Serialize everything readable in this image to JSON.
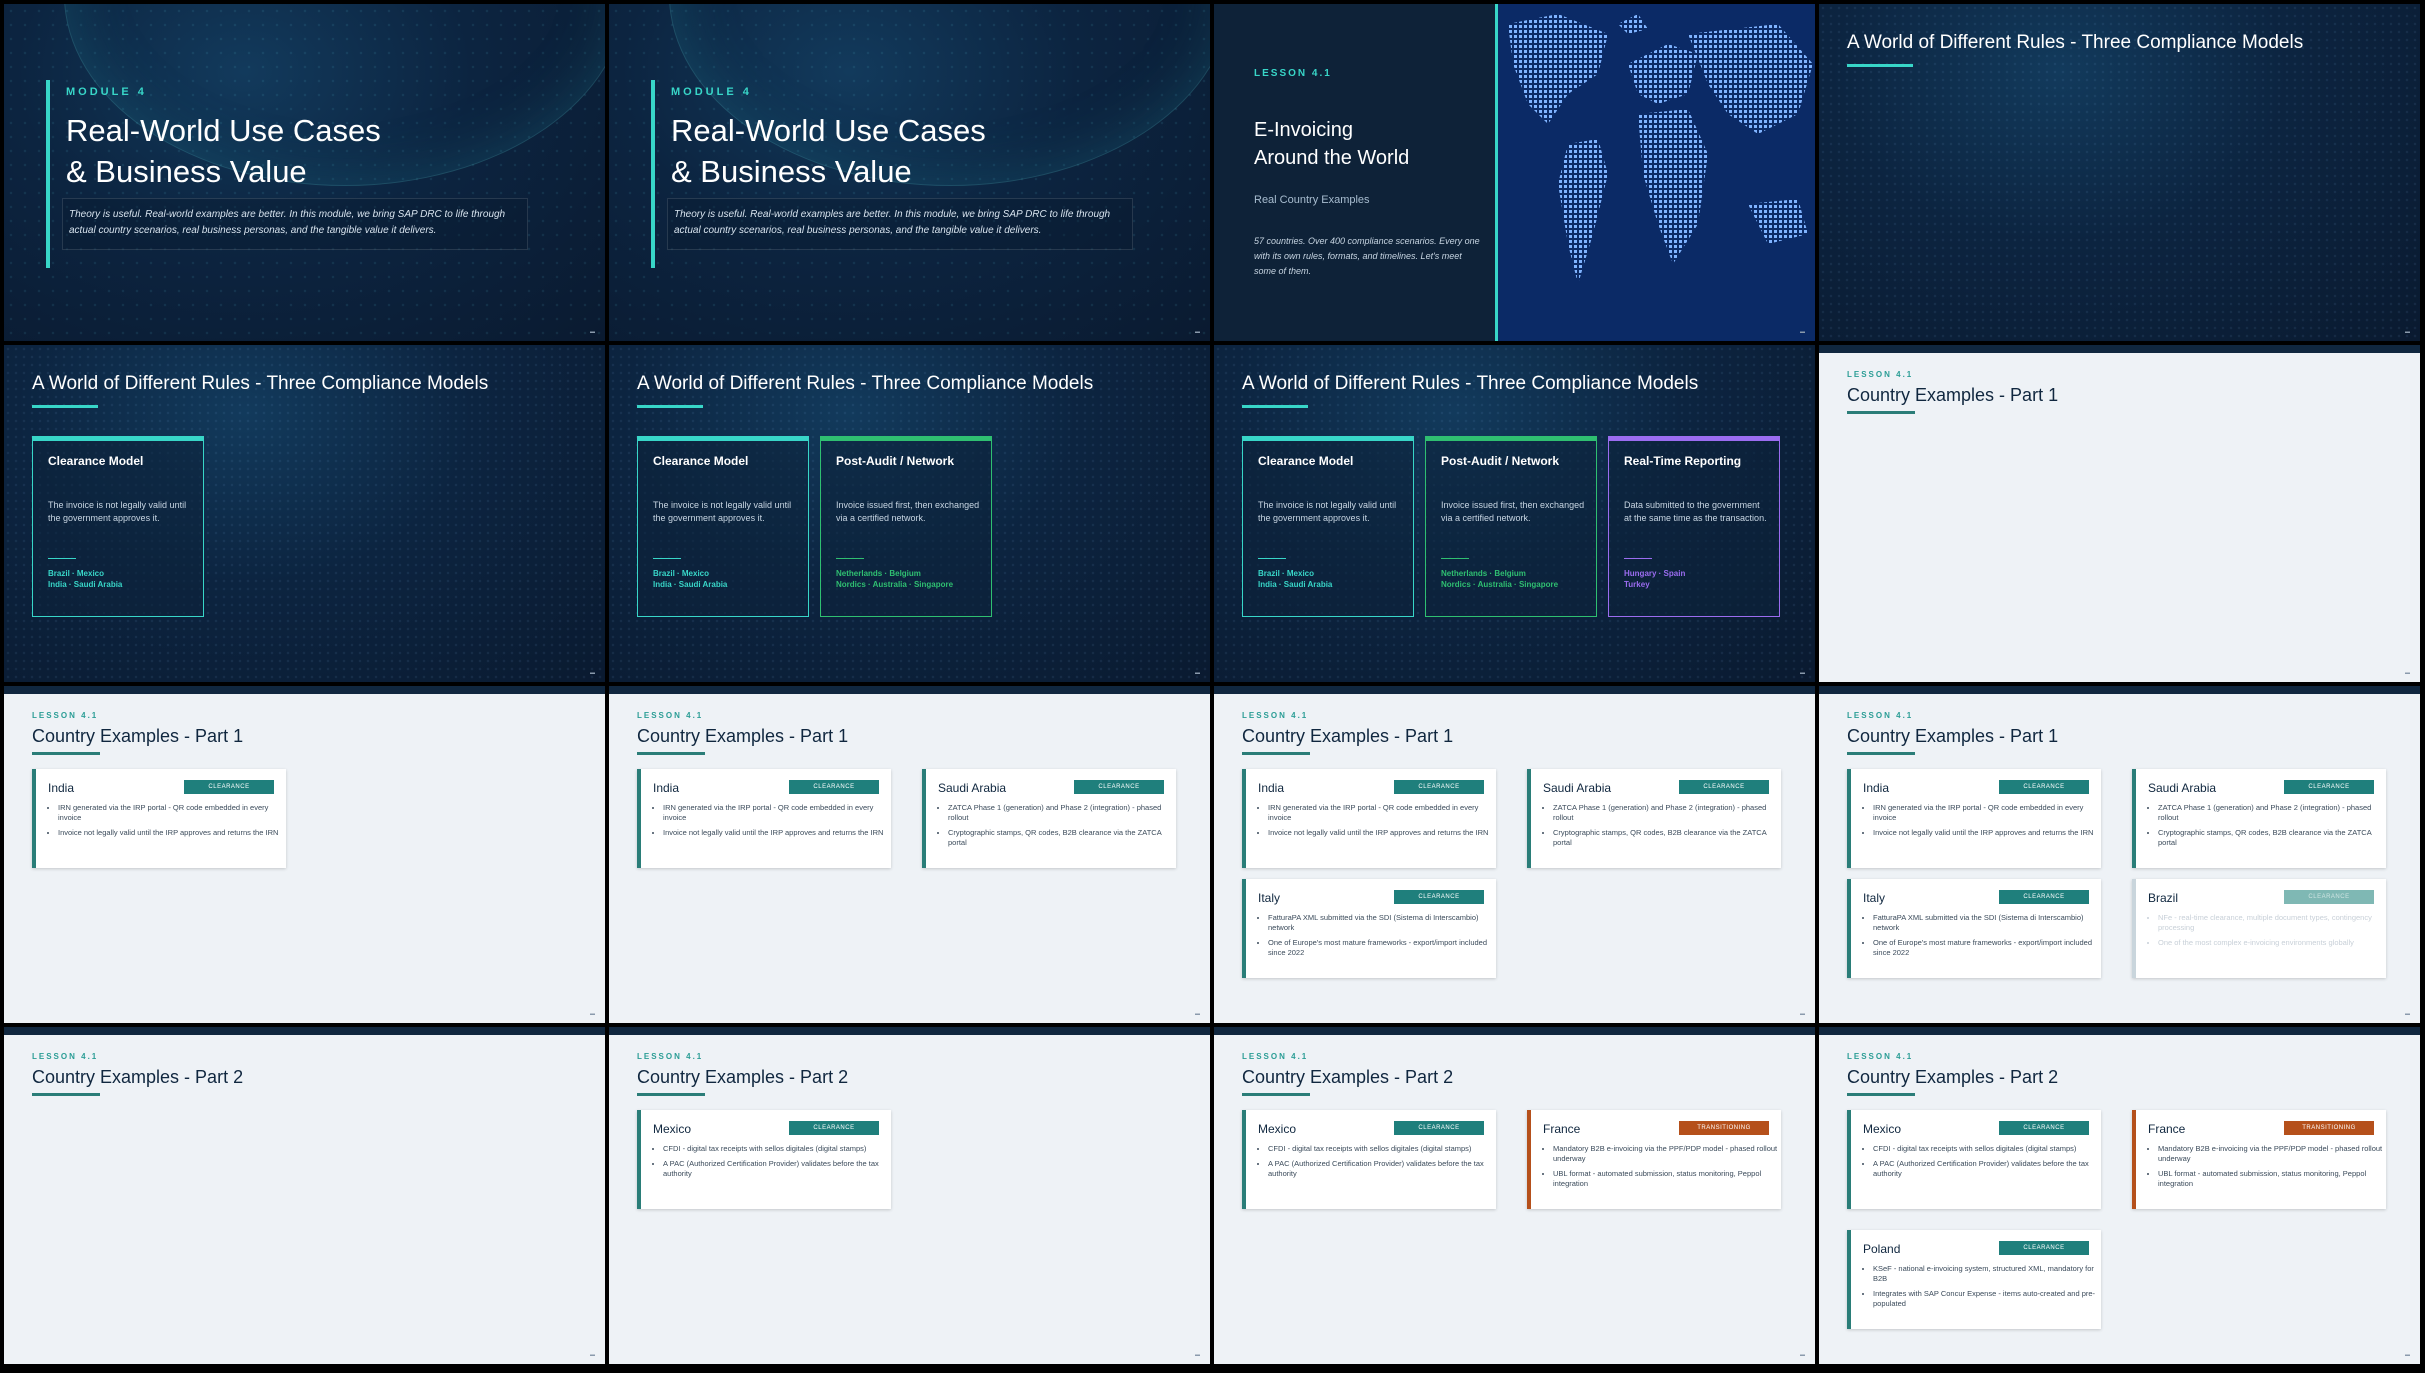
{
  "colors": {
    "accent_teal": "#38d6c8",
    "clearance": "#1f7f7c",
    "post_audit": "#2fbf71",
    "realtime": "#9b6cf0",
    "transitioning": "#b5501b",
    "dark_bg": "#0c2440",
    "light_bg": "#eef2f6"
  },
  "title_slide": {
    "module": "MODULE 4",
    "title_line1": "Real-World Use Cases",
    "title_line2": "& Business Value",
    "description": "Theory is useful. Real-world examples are better. In this module, we bring SAP DRC to life through actual country scenarios, real business personas, and the tangible value it delivers."
  },
  "lesson_slide": {
    "lesson": "LESSON 4.1",
    "title_line1": "E-Invoicing",
    "title_line2": "Around the World",
    "subtitle": "Real Country Examples",
    "description": "57 countries. Over 400 compliance scenarios. Every one with its own rules, formats, and timelines. Let's meet some of them."
  },
  "compliance": {
    "title": "A World of Different Rules - Three Compliance Models",
    "models": [
      {
        "title": "Clearance Model",
        "desc": "The invoice is not legally valid until the government approves it.",
        "countries_line1": "Brazil · Mexico",
        "countries_line2": "India · Saudi Arabia"
      },
      {
        "title": "Post-Audit / Network",
        "desc": "Invoice issued first, then exchanged via a certified network.",
        "countries_line1": "Netherlands · Belgium",
        "countries_line2": "Nordics · Australia · Singapore"
      },
      {
        "title": "Real-Time Reporting",
        "desc": "Data submitted to the government at the same time as the transaction.",
        "countries_line1": "Hungary · Spain",
        "countries_line2": "Turkey"
      }
    ]
  },
  "country": {
    "lesson": "LESSON 4.1",
    "part1_title": "Country Examples - Part 1",
    "part2_title": "Country Examples - Part 2",
    "badge_clearance": "CLEARANCE",
    "badge_transitioning": "TRANSITIONING",
    "india": {
      "name": "India",
      "b1": "IRN generated via the IRP portal - QR code embedded in every invoice",
      "b2": "Invoice not legally valid until the IRP approves and returns the IRN"
    },
    "saudi": {
      "name": "Saudi Arabia",
      "b1": "ZATCA Phase 1 (generation) and Phase 2 (integration) - phased rollout",
      "b2": "Cryptographic stamps, QR codes, B2B clearance via the ZATCA portal"
    },
    "italy": {
      "name": "Italy",
      "b1": "FatturaPA XML submitted via the SDI (Sistema di Interscambio) network",
      "b2": "One of Europe's most mature frameworks - export/import included since 2022"
    },
    "brazil": {
      "name": "Brazil",
      "b1": "NFe - real-time clearance, multiple document types, contingency processing",
      "b2": "One of the most complex e-invoicing environments globally"
    },
    "mexico": {
      "name": "Mexico",
      "b1": "CFDI - digital tax receipts with sellos digitales (digital stamps)",
      "b2": "A PAC (Authorized Certification Provider) validates before the tax authority"
    },
    "france": {
      "name": "France",
      "b1": "Mandatory B2B e-invoicing via the PPF/PDP model - phased rollout underway",
      "b2": "UBL format - automated submission, status monitoring, Peppol integration"
    },
    "poland": {
      "name": "Poland",
      "b1": "KSeF - national e-invoicing system, structured XML, mandatory for B2B",
      "b2": "Integrates with SAP Concur Expense - items auto-created and pre-populated"
    }
  }
}
